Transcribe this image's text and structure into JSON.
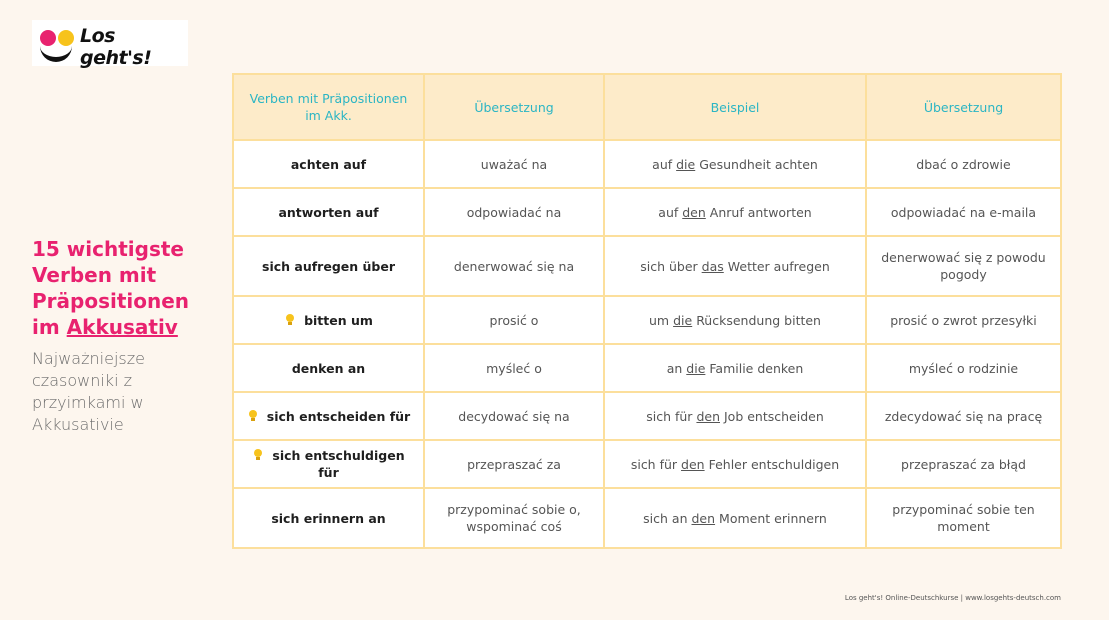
{
  "logo": {
    "text": "Los geht's!"
  },
  "title": {
    "line1": "15 wichtigste",
    "line2": "Verben mit",
    "line3": "Präpositionen",
    "line4_prefix": "im",
    "line4_underlined": "Akkusativ"
  },
  "subtitle": "Najważniejsze czasowniki z przyimkami w Akkusativie",
  "table": {
    "headers": [
      "Verben mit Präpositionen im Akk.",
      "Übersetzung",
      "Beispiel",
      "Übersetzung"
    ],
    "rows": [
      {
        "verb": "achten auf",
        "translation": "uważać na",
        "example_pre": "auf",
        "example_article": "die",
        "example_post": "Gesundheit achten",
        "example_translation": "dbać o zdrowie",
        "bulb": false
      },
      {
        "verb": "antworten auf",
        "translation": "odpowiadać na",
        "example_pre": "auf",
        "example_article": "den",
        "example_post": "Anruf antworten",
        "example_translation": "odpowiadać na e-maila",
        "bulb": false
      },
      {
        "verb": "sich aufregen über",
        "translation": "denerwować się na",
        "example_pre": "sich über",
        "example_article": "das",
        "example_post": "Wetter aufregen",
        "example_translation": "denerwować się z powodu pogody",
        "bulb": false
      },
      {
        "verb": "bitten um",
        "translation": "prosić o",
        "example_pre": "um",
        "example_article": "die",
        "example_post": "Rücksendung bitten",
        "example_translation": "prosić o zwrot przesyłki",
        "bulb": true
      },
      {
        "verb": "denken an",
        "translation": "myśleć o",
        "example_pre": "an",
        "example_article": "die",
        "example_post": "Familie denken",
        "example_translation": "myśleć o rodzinie",
        "bulb": false
      },
      {
        "verb": "sich entscheiden für",
        "translation": "decydować się na",
        "example_pre": "sich für",
        "example_article": "den",
        "example_post": "Job entscheiden",
        "example_translation": "zdecydować się na pracę",
        "bulb": true
      },
      {
        "verb": "sich entschuldigen für",
        "translation": "przepraszać za",
        "example_pre": "sich für",
        "example_article": "den",
        "example_post": "Fehler entschuldigen",
        "example_translation": "przepraszać za błąd",
        "bulb": true
      },
      {
        "verb": "sich erinnern an",
        "translation": "przypominać sobie o, wspominać coś",
        "example_pre": "sich an",
        "example_article": "den",
        "example_post": "Moment erinnern",
        "example_translation": "przypominać sobie ten moment",
        "bulb": false
      }
    ]
  },
  "footer": "Los geht's! Online-Deutschkurse  |  www.losgehts-deutsch.com",
  "colors": {
    "accent": "#e8226f",
    "header_text": "#2bb5c4",
    "border": "#fcdf9c",
    "header_bg": "#fdebc9"
  }
}
